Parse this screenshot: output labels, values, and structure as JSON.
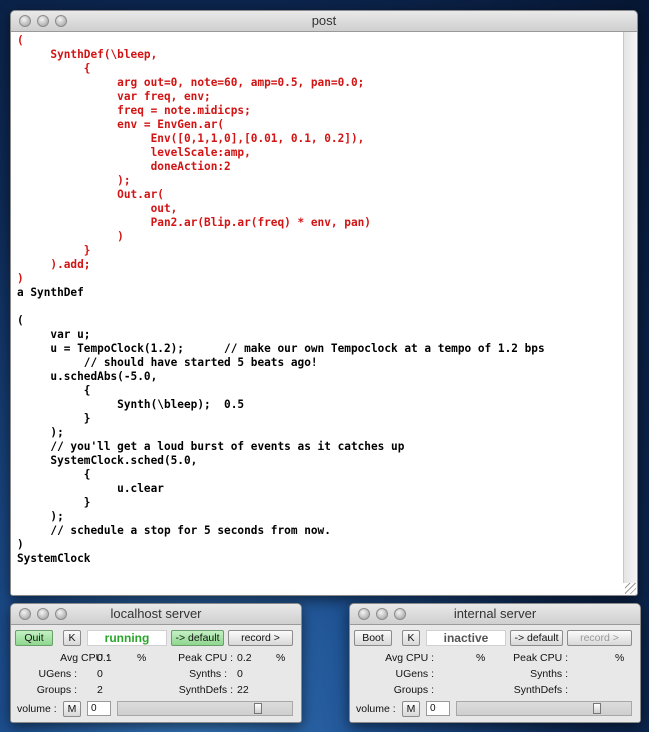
{
  "post_window": {
    "title": "post",
    "code_lines": [
      {
        "text": "(",
        "red": true
      },
      {
        "text": "     SynthDef(\\bleep,",
        "red": true
      },
      {
        "text": "          {",
        "red": true
      },
      {
        "text": "               arg out=0, note=60, amp=0.5, pan=0.0;",
        "red": true
      },
      {
        "text": "               var freq, env;",
        "red": true
      },
      {
        "text": "               freq = note.midicps;",
        "red": true
      },
      {
        "text": "               env = EnvGen.ar(",
        "red": true
      },
      {
        "text": "                    Env([0,1,1,0],[0.01, 0.1, 0.2]),",
        "red": true
      },
      {
        "text": "                    levelScale:amp,",
        "red": true
      },
      {
        "text": "                    doneAction:2",
        "red": true
      },
      {
        "text": "               );",
        "red": true
      },
      {
        "text": "               Out.ar(",
        "red": true
      },
      {
        "text": "                    out,",
        "red": true
      },
      {
        "text": "                    Pan2.ar(Blip.ar(freq) * env, pan)",
        "red": true
      },
      {
        "text": "               )",
        "red": true
      },
      {
        "text": "          }",
        "red": true
      },
      {
        "text": "     ).add;",
        "red": true
      },
      {
        "text": ")",
        "red": true
      },
      {
        "text": "a SynthDef",
        "red": false
      },
      {
        "text": "",
        "red": false
      },
      {
        "text": "(",
        "red": false
      },
      {
        "text": "     var u;",
        "red": false
      },
      {
        "text": "     u = TempoClock(1.2);      // make our own Tempoclock at a tempo of 1.2 bps",
        "red": false
      },
      {
        "text": "          // should have started 5 beats ago!",
        "red": false
      },
      {
        "text": "     u.schedAbs(-5.0,",
        "red": false
      },
      {
        "text": "          {",
        "red": false
      },
      {
        "text": "               Synth(\\bleep);  0.5",
        "red": false
      },
      {
        "text": "          }",
        "red": false
      },
      {
        "text": "     );",
        "red": false
      },
      {
        "text": "     // you'll get a loud burst of events as it catches up",
        "red": false
      },
      {
        "text": "     SystemClock.sched(5.0,",
        "red": false
      },
      {
        "text": "          {",
        "red": false
      },
      {
        "text": "               u.clear",
        "red": false
      },
      {
        "text": "          }",
        "red": false
      },
      {
        "text": "     );",
        "red": false
      },
      {
        "text": "     // schedule a stop for 5 seconds from now.",
        "red": false
      },
      {
        "text": ")",
        "red": false
      },
      {
        "text": "SystemClock",
        "red": false
      }
    ]
  },
  "localhost_server": {
    "title": "localhost server",
    "quit_label": "Quit",
    "kill_label": "K",
    "status": "running",
    "default_label": "-> default",
    "record_label": "record >",
    "avg_cpu_label": "Avg CPU :",
    "avg_cpu_value": "0.1",
    "avg_cpu_unit": "%",
    "peak_cpu_label": "Peak CPU :",
    "peak_cpu_value": "0.2",
    "peak_cpu_unit": "%",
    "ugens_label": "UGens :",
    "ugens_value": "0",
    "synths_label": "Synths :",
    "synths_value": "0",
    "groups_label": "Groups :",
    "groups_value": "2",
    "synthdefs_label": "SynthDefs :",
    "synthdefs_value": "22",
    "volume_label": "volume :",
    "mute_label": "M",
    "volume_value": "0",
    "volume_level": 0.82
  },
  "internal_server": {
    "title": "internal server",
    "boot_label": "Boot",
    "kill_label": "K",
    "status": "inactive",
    "default_label": "-> default",
    "record_label": "record >",
    "avg_cpu_label": "Avg CPU :",
    "avg_cpu_unit": "%",
    "peak_cpu_label": "Peak CPU :",
    "peak_cpu_unit": "%",
    "ugens_label": "UGens :",
    "synths_label": "Synths :",
    "groups_label": "Groups :",
    "synthdefs_label": "SynthDefs :",
    "volume_label": "volume :",
    "mute_label": "M",
    "volume_value": "0",
    "volume_level": 0.82
  },
  "colors": {
    "code_red": "#d21414",
    "running_green": "#2aa52a",
    "button_green": "#8ed68e"
  }
}
